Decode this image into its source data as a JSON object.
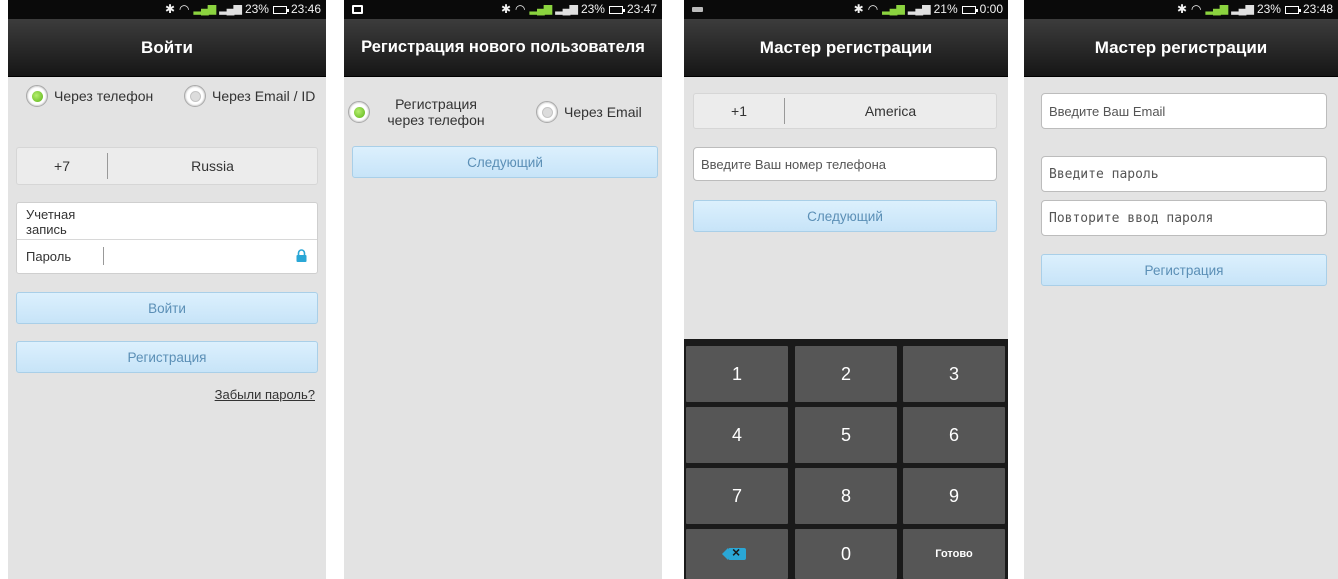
{
  "screens": [
    {
      "status": {
        "battery": "23%",
        "time": "23:46"
      },
      "title": "Войти",
      "radio_phone": "Через телефон",
      "radio_email": "Через Email / ID",
      "country_code": "+7",
      "country_name": "Russia",
      "account_label": "Учетная запись",
      "password_label": "Пароль",
      "login_button": "Войти",
      "register_button": "Регистрация",
      "forgot_link": "Забыли пароль?"
    },
    {
      "status": {
        "battery": "23%",
        "time": "23:47"
      },
      "title": "Регистрация нового пользователя",
      "radio_phone": "Регистрация через телефон",
      "radio_email": "Через Email",
      "next_button": "Следующий"
    },
    {
      "status": {
        "battery": "21%",
        "time": "0:00"
      },
      "title": "Мастер регистрации",
      "country_code": "+1",
      "country_name": "America",
      "phone_placeholder": "Введите Ваш номер телефона",
      "next_button": "Следующий",
      "keys": [
        "1",
        "2",
        "3",
        "4",
        "5",
        "6",
        "7",
        "8",
        "9",
        "0"
      ],
      "done_key": "Готово"
    },
    {
      "status": {
        "battery": "23%",
        "time": "23:48"
      },
      "title": "Мастер регистрации",
      "email_placeholder": "Введите Ваш Email",
      "password_placeholder": "Введите пароль",
      "repeat_password_placeholder": "Повторите ввод пароля",
      "register_button": "Регистрация"
    }
  ],
  "colors": {
    "accent_green": "#5bb317",
    "button_text": "#5b8fb6",
    "signal": "#8bd33f"
  }
}
